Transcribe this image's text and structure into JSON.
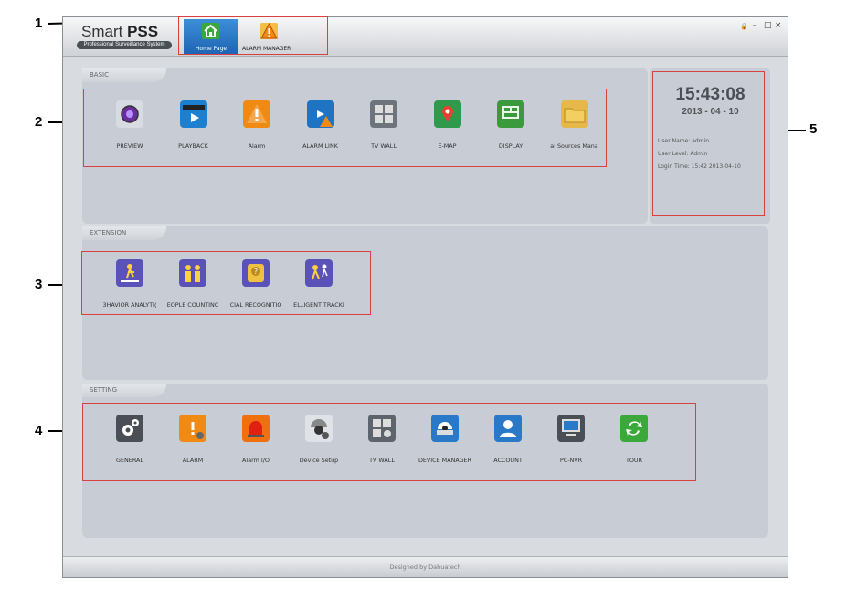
{
  "callouts": [
    "1",
    "2",
    "3",
    "4",
    "5"
  ],
  "app": {
    "logo": {
      "text_light": "Smart ",
      "text_bold": "PSS",
      "subtitle": "Professional Surveillance System"
    },
    "tabs": [
      {
        "label": "Home Page",
        "icon": "house-icon",
        "color": "#3aa83a"
      },
      {
        "label": "ALARM MANAGER",
        "icon": "warning-icon",
        "color": "#f09010"
      }
    ],
    "window_controls": {
      "lock": "🔒",
      "minimize": "–",
      "maximize": "□",
      "close": "×"
    }
  },
  "panels": {
    "basic": {
      "title": "BASIC",
      "items": [
        {
          "label": "PREVIEW",
          "icon": "camera-icon",
          "color": "#d8dce2"
        },
        {
          "label": "PLAYBACK",
          "icon": "playback-icon",
          "color": "#1d7fd0"
        },
        {
          "label": "Alarm",
          "icon": "alarm-icon",
          "color": "#f08a12"
        },
        {
          "label": "ALARM LINK",
          "icon": "alarm-link-icon",
          "color": "#1e73c2"
        },
        {
          "label": "TV WALL",
          "icon": "tv-wall-icon",
          "color": "#6e747b"
        },
        {
          "label": "E-MAP",
          "icon": "map-icon",
          "color": "#2f9a4c"
        },
        {
          "label": "DISPLAY",
          "icon": "display-icon",
          "color": "#3b9a3b"
        },
        {
          "label": "al Sources Mana",
          "icon": "folder-icon",
          "color": "#e6b84a"
        }
      ]
    },
    "extension": {
      "title": "EXTENSION",
      "items": [
        {
          "label": "3HAVIOR ANALYTI(",
          "icon": "behavior-icon",
          "color": "#5a52b8"
        },
        {
          "label": "EOPLE COUNTINC",
          "icon": "people-icon",
          "color": "#5a52b8"
        },
        {
          "label": "CIAL RECOGNITIO",
          "icon": "face-icon",
          "color": "#5a52b8"
        },
        {
          "label": "ELLIGENT TRACKI",
          "icon": "tracking-icon",
          "color": "#5a52b8"
        }
      ]
    },
    "setting": {
      "title": "SETTING",
      "items": [
        {
          "label": "GENERAL",
          "icon": "gear-icon",
          "color": "#4a4f55"
        },
        {
          "label": "ALARM",
          "icon": "alarm-setting-icon",
          "color": "#f08a12"
        },
        {
          "label": "Alarm I/O",
          "icon": "siren-icon",
          "color": "#f07010"
        },
        {
          "label": "Device Setup",
          "icon": "dome-camera-icon",
          "color": "#dfe2e6"
        },
        {
          "label": "TV WALL",
          "icon": "tv-wall-setting-icon",
          "color": "#5e646b"
        },
        {
          "label": "DEVICE MANAGER",
          "icon": "device-manager-icon",
          "color": "#2a78c8"
        },
        {
          "label": "ACCOUNT",
          "icon": "account-icon",
          "color": "#2a78c8"
        },
        {
          "label": "PC-NVR",
          "icon": "pc-nvr-icon",
          "color": "#4a4f55"
        },
        {
          "label": "TOUR",
          "icon": "tour-icon",
          "color": "#3aa83a"
        }
      ]
    }
  },
  "info": {
    "time": "15:43:08",
    "date": "2013 - 04 - 10",
    "user_name": "User Name: admin",
    "user_level": "User Level:  Admin",
    "login_time": "Login Time: 15:42 2013-04-10"
  },
  "footer": {
    "text": "Designed by Dahuatech"
  }
}
